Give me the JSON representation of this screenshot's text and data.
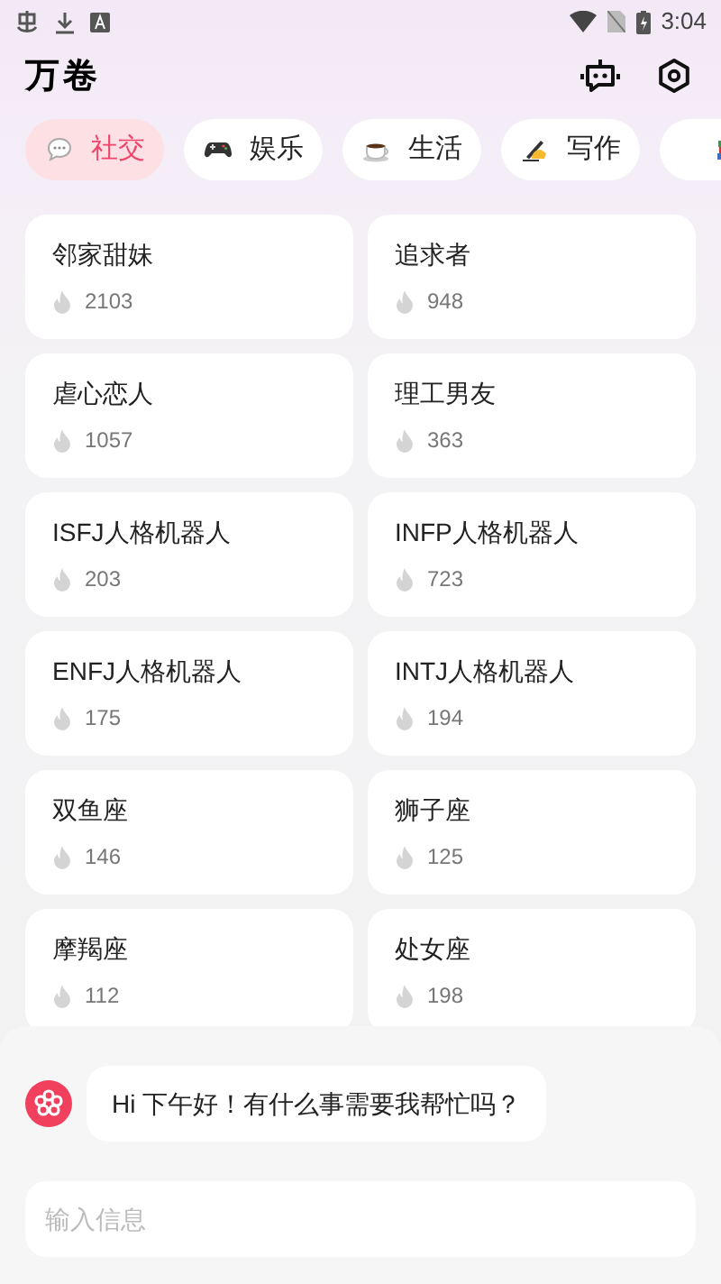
{
  "status_bar": {
    "time": "3:04"
  },
  "app_title": "万卷",
  "tabs": [
    {
      "label": "社交",
      "selected": true
    },
    {
      "label": "娱乐",
      "selected": false
    },
    {
      "label": "生活",
      "selected": false
    },
    {
      "label": "写作",
      "selected": false
    },
    {
      "selected": false
    }
  ],
  "cards": [
    {
      "name": "邻家甜妹",
      "count": "2103"
    },
    {
      "name": "追求者",
      "count": "948"
    },
    {
      "name": "虐心恋人",
      "count": "1057"
    },
    {
      "name": "理工男友",
      "count": "363"
    },
    {
      "name": "ISFJ人格机器人",
      "count": "203"
    },
    {
      "name": "INFP人格机器人",
      "count": "723"
    },
    {
      "name": "ENFJ人格机器人",
      "count": "175"
    },
    {
      "name": "INTJ人格机器人",
      "count": "194"
    },
    {
      "name": "双鱼座",
      "count": "146"
    },
    {
      "name": "狮子座",
      "count": "125"
    },
    {
      "name": "摩羯座",
      "count": "112"
    },
    {
      "name": "处女座",
      "count": "198"
    }
  ],
  "chat": {
    "message": "Hi 下午好！有什么事需要我帮忙吗？",
    "input_placeholder": "输入信息"
  }
}
